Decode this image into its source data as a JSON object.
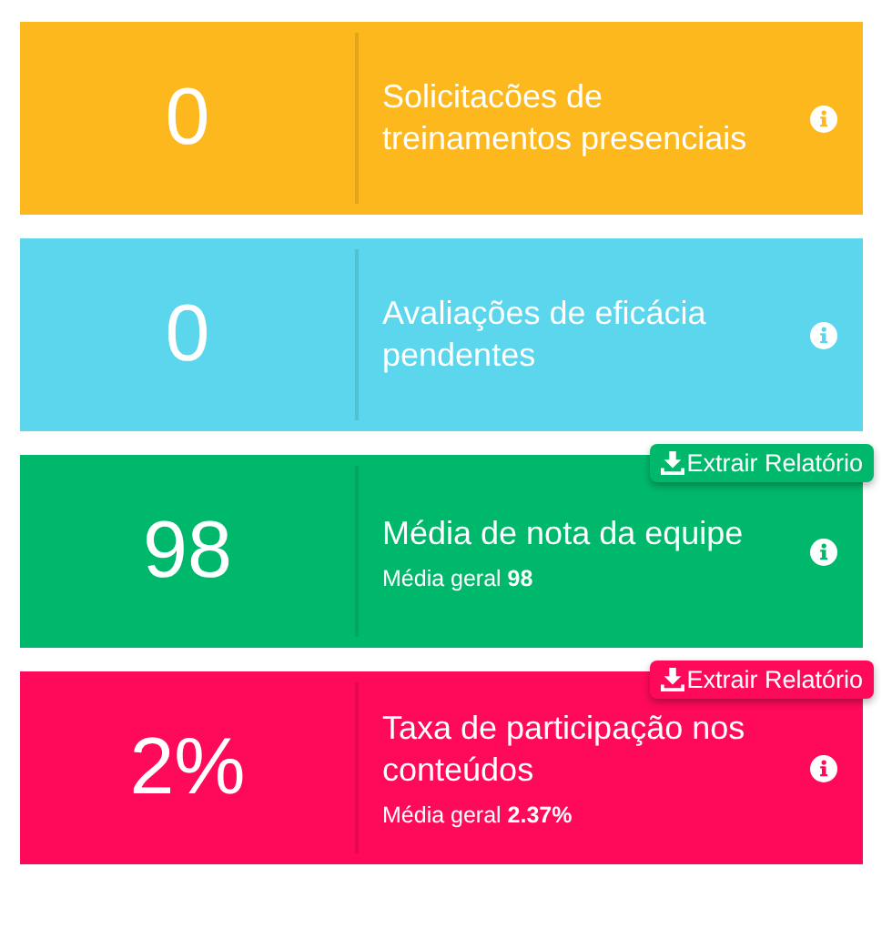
{
  "cards": [
    {
      "value": "0",
      "title": "Solicitacões de treinamentos presenciais",
      "color": "#fdb81e"
    },
    {
      "value": "0",
      "title": "Avaliações de eficácia pendentes",
      "color": "#5bd6ec"
    },
    {
      "value": "98",
      "title": "Média de nota da equipe",
      "subtitle": "Média geral **98**",
      "button": "Extrair Relatório",
      "color": "#00b86b"
    },
    {
      "value": "2%",
      "title": "Taxa de participação nos conteúdos",
      "subtitle": "Média geral **2.37%**",
      "button": "Extrair Relatório",
      "color": "#ff0a5a"
    }
  ]
}
